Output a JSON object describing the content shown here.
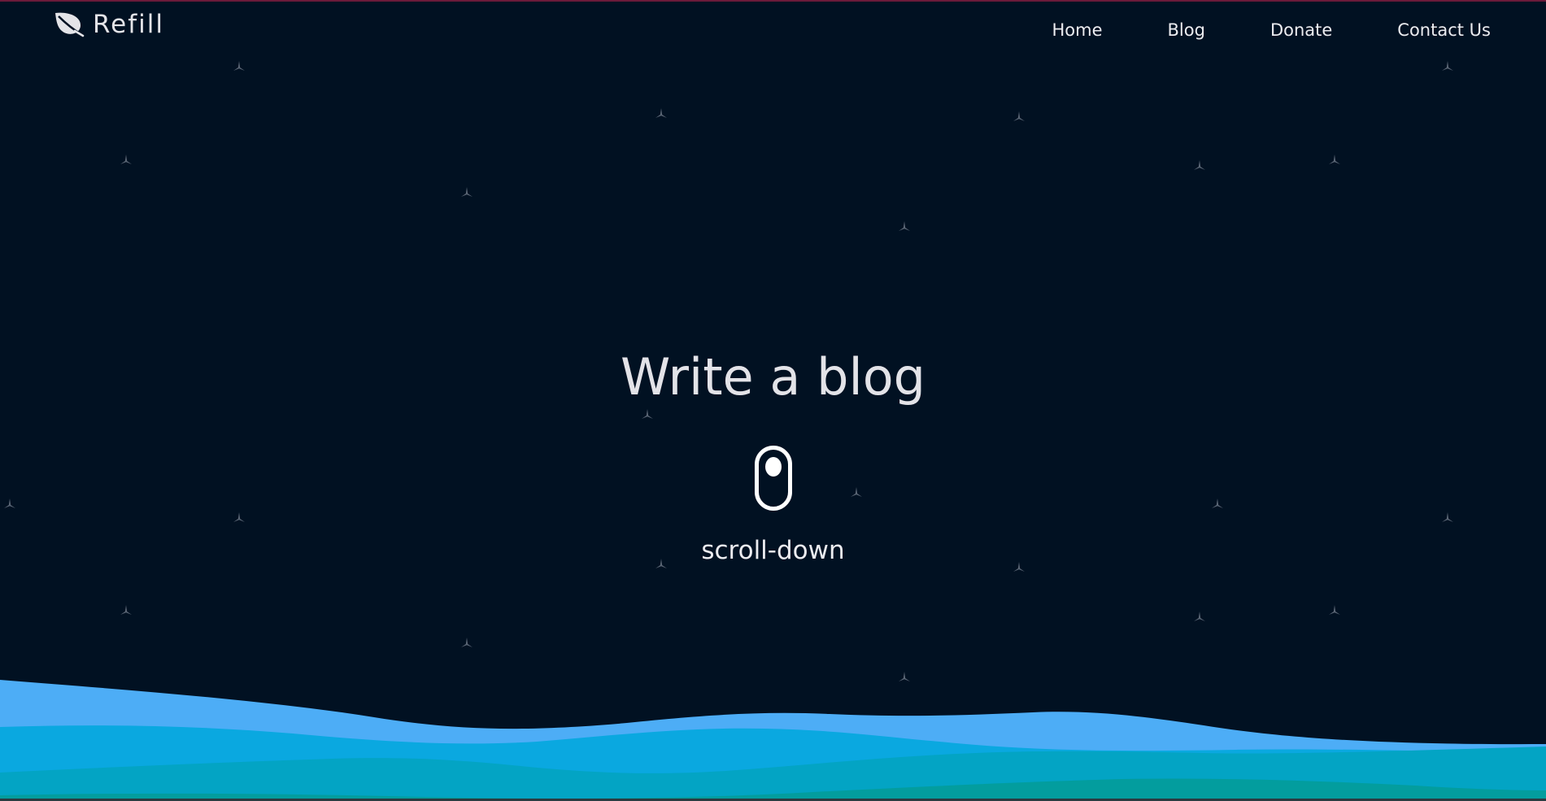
{
  "brand": {
    "name": "Refill",
    "logo_icon": "leaf-icon"
  },
  "nav": {
    "items": [
      {
        "label": "Home"
      },
      {
        "label": "Blog"
      },
      {
        "label": "Donate"
      },
      {
        "label": "Contact Us"
      }
    ]
  },
  "hero": {
    "title": "Write a blog",
    "scroll_icon": "mouse-scroll-icon",
    "scroll_label": "scroll-down"
  },
  "colors": {
    "background": "#011122",
    "wave_light": "#4dadf6",
    "wave_mid": "#0aa8e0",
    "wave_teal": "#03a4c4",
    "wave_deep": "#039d9e",
    "text": "#e6e6ea"
  }
}
